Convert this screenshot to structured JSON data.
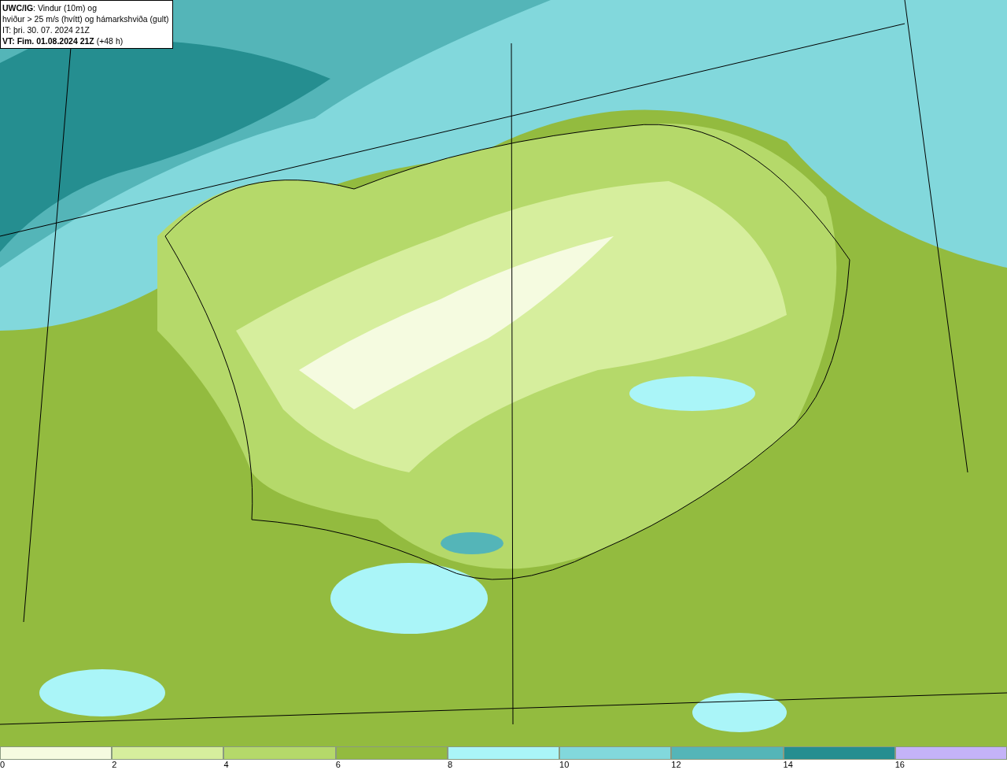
{
  "title_box": {
    "lines": [
      "**UWC/IG**: Vindur (10m) og",
      "hviður > 25 m/s (hvítt) og hámarkshviða (gult)",
      "IT: þri. 30. 07. 2024 21Z",
      "**VT: Fim. 01.08.2024 21Z** (+48 h)"
    ]
  },
  "legend": [
    {
      "label": "0",
      "color": "#f5fbe0"
    },
    {
      "label": "2",
      "color": "#d6ee9d"
    },
    {
      "label": "4",
      "color": "#b5d96a"
    },
    {
      "label": "6",
      "color": "#93bb3f"
    },
    {
      "label": "8",
      "color": "#aaf5f8"
    },
    {
      "label": "10",
      "color": "#82d8dc"
    },
    {
      "label": "12",
      "color": "#54b5b8"
    },
    {
      "label": "14",
      "color": "#258e90"
    },
    {
      "label": "16",
      "color": "#c4b3f8"
    }
  ]
}
